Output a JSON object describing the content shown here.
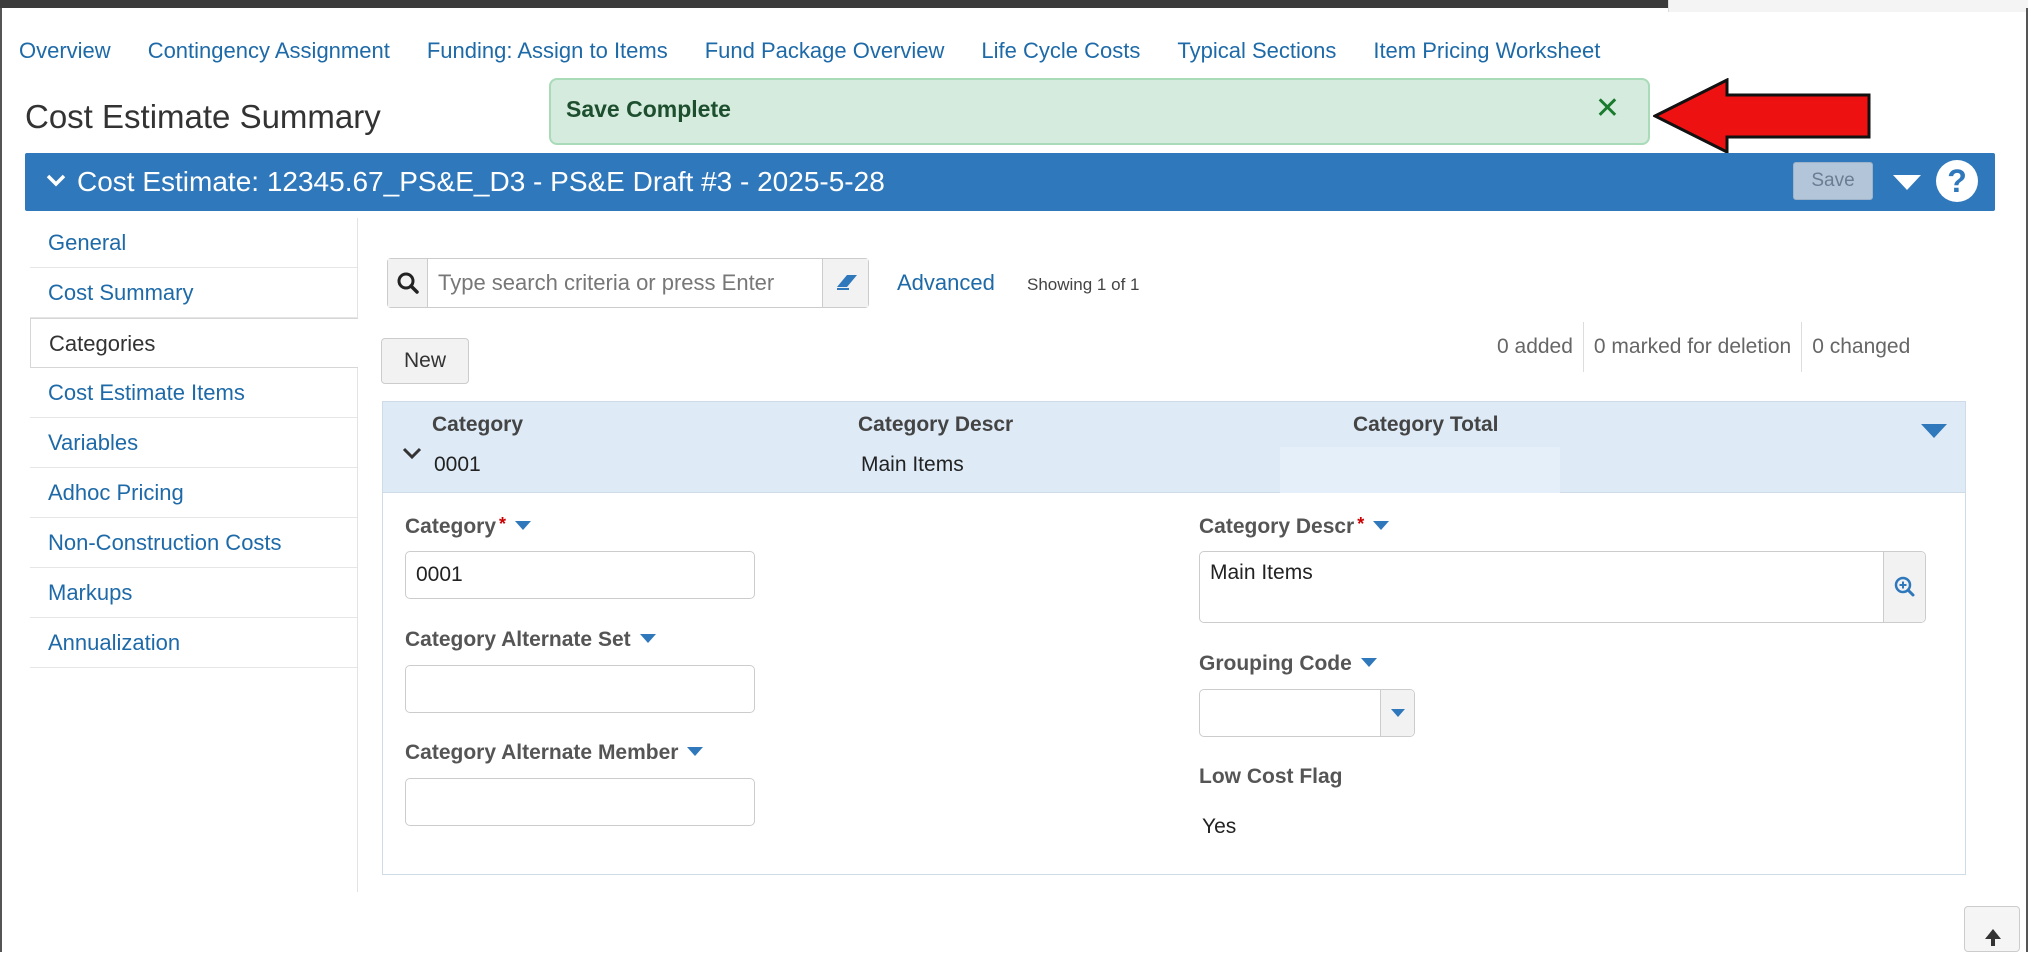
{
  "nav": {
    "links": [
      "Overview",
      "Contingency Assignment",
      "Funding: Assign to Items",
      "Fund Package Overview",
      "Life Cycle Costs",
      "Typical Sections",
      "Item Pricing Worksheet"
    ]
  },
  "page": {
    "title": "Cost Estimate Summary"
  },
  "toast": {
    "message": "Save Complete",
    "close_icon": "close-icon",
    "color": "#d4ebdd"
  },
  "header": {
    "title": "Cost Estimate: 12345.67_PS&E_D3 - PS&E Draft #3 - 2025-5-28",
    "save_label": "Save",
    "help_label": "?",
    "color": "#2f78bb"
  },
  "sidebar": {
    "items": [
      {
        "label": "General",
        "active": false
      },
      {
        "label": "Cost Summary",
        "active": false
      },
      {
        "label": "Categories",
        "active": true
      },
      {
        "label": "Cost Estimate Items",
        "active": false
      },
      {
        "label": "Variables",
        "active": false
      },
      {
        "label": "Adhoc Pricing",
        "active": false
      },
      {
        "label": "Non-Construction Costs",
        "active": false
      },
      {
        "label": "Markups",
        "active": false
      },
      {
        "label": "Annualization",
        "active": false
      }
    ]
  },
  "search": {
    "placeholder": "Type search criteria or press Enter",
    "value": "",
    "advanced_label": "Advanced",
    "showing": "Showing 1 of 1"
  },
  "toolbar": {
    "new_label": "New",
    "added": "0 added",
    "marked": "0 marked for deletion",
    "changed": "0 changed"
  },
  "grid": {
    "headers": {
      "category": "Category",
      "descr": "Category Descr",
      "total": "Category Total"
    },
    "row": {
      "category": "0001",
      "descr": "Main Items",
      "total": ""
    }
  },
  "form": {
    "category_label": "Category",
    "category_value": "0001",
    "alt_set_label": "Category Alternate Set",
    "alt_set_value": "",
    "alt_member_label": "Category Alternate Member",
    "alt_member_value": "",
    "descr_label": "Category Descr",
    "descr_value": "Main Items",
    "grouping_label": "Grouping Code",
    "grouping_value": "",
    "low_cost_label": "Low Cost Flag",
    "low_cost_value": "Yes",
    "required_marker": "*"
  }
}
